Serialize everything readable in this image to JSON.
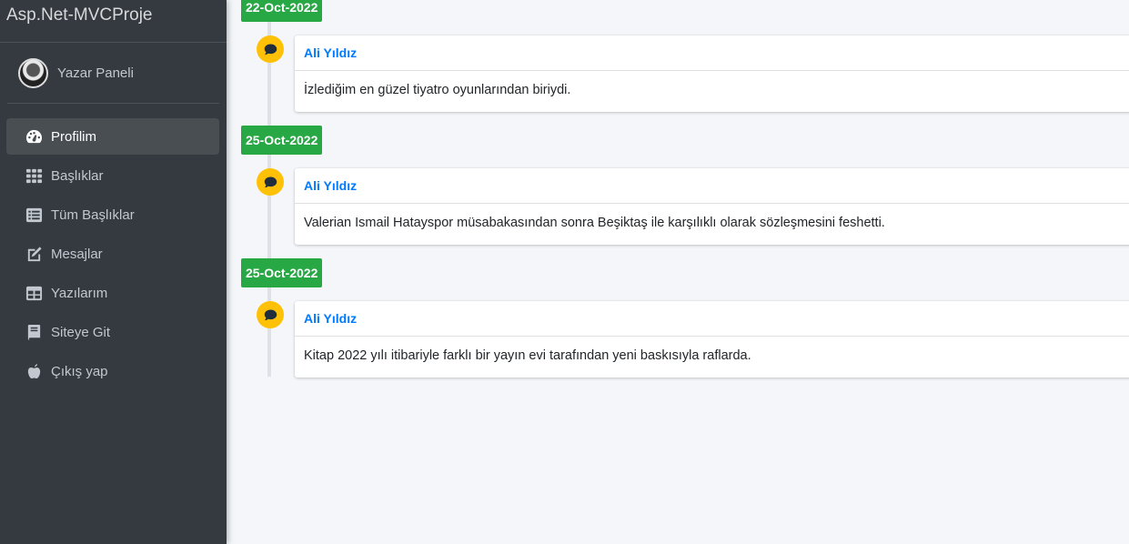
{
  "app": {
    "brand": "Asp.Net-MVCProje"
  },
  "user": {
    "name": "Yazar Paneli"
  },
  "nav": {
    "items": [
      {
        "label": "Profilim",
        "icon": "tachometer-icon",
        "active": true
      },
      {
        "label": "Başlıklar",
        "icon": "grid-icon"
      },
      {
        "label": "Tüm Başlıklar",
        "icon": "list-icon"
      },
      {
        "label": "Mesajlar",
        "icon": "edit-icon"
      },
      {
        "label": "Yazılarım",
        "icon": "table-icon"
      },
      {
        "label": "Siteye Git",
        "icon": "book-icon"
      },
      {
        "label": "Çıkış yap",
        "icon": "apple-icon"
      }
    ]
  },
  "timeline": [
    {
      "date": "22-Oct-2022",
      "author": "Ali Yıldız",
      "text": "İzlediğim en güzel tiyatro oyunlarından biriydi."
    },
    {
      "date": "25-Oct-2022",
      "author": "Ali Yıldız",
      "text": "Valerian Ismail Hatayspor müsabakasından sonra Beşiktaş ile karşılıklı olarak sözleşmesini feshetti."
    },
    {
      "date": "25-Oct-2022",
      "author": "Ali Yıldız",
      "text": "Kitap 2022 yılı itibariyle farklı bir yayın evi tarafından yeni baskısıyla raflarda."
    }
  ],
  "colors": {
    "sidebar": "#343a40",
    "date_badge": "#28a745",
    "comment_bubble": "#ffc107",
    "author_link": "#007bff"
  }
}
